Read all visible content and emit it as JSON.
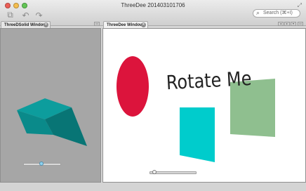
{
  "window": {
    "title": "ThreeDee 201403101706",
    "search": {
      "label": "Search (⌘+I)",
      "icon": "search-icon"
    },
    "toolbar": [
      {
        "name": "cube-tool-icon",
        "glyph": "⧉"
      },
      {
        "name": "undo-icon",
        "glyph": "↶"
      },
      {
        "name": "redo-icon",
        "glyph": "↷"
      }
    ]
  },
  "left_panel": {
    "tab_label": "ThreeDSolid Window",
    "slider_value": 0.5
  },
  "right_panel": {
    "tab_label": "ThreeDee Window",
    "rotate_text": "Rotate Me",
    "slider_value": 0.1
  },
  "colors": {
    "cube_top": "#0d9d9d",
    "cube_side": "#0a7c7c",
    "cube_front": "#087070",
    "ellipse": "#dc143c",
    "cyan_quad": "#00cccc",
    "green_quad": "#8fbf8f"
  }
}
